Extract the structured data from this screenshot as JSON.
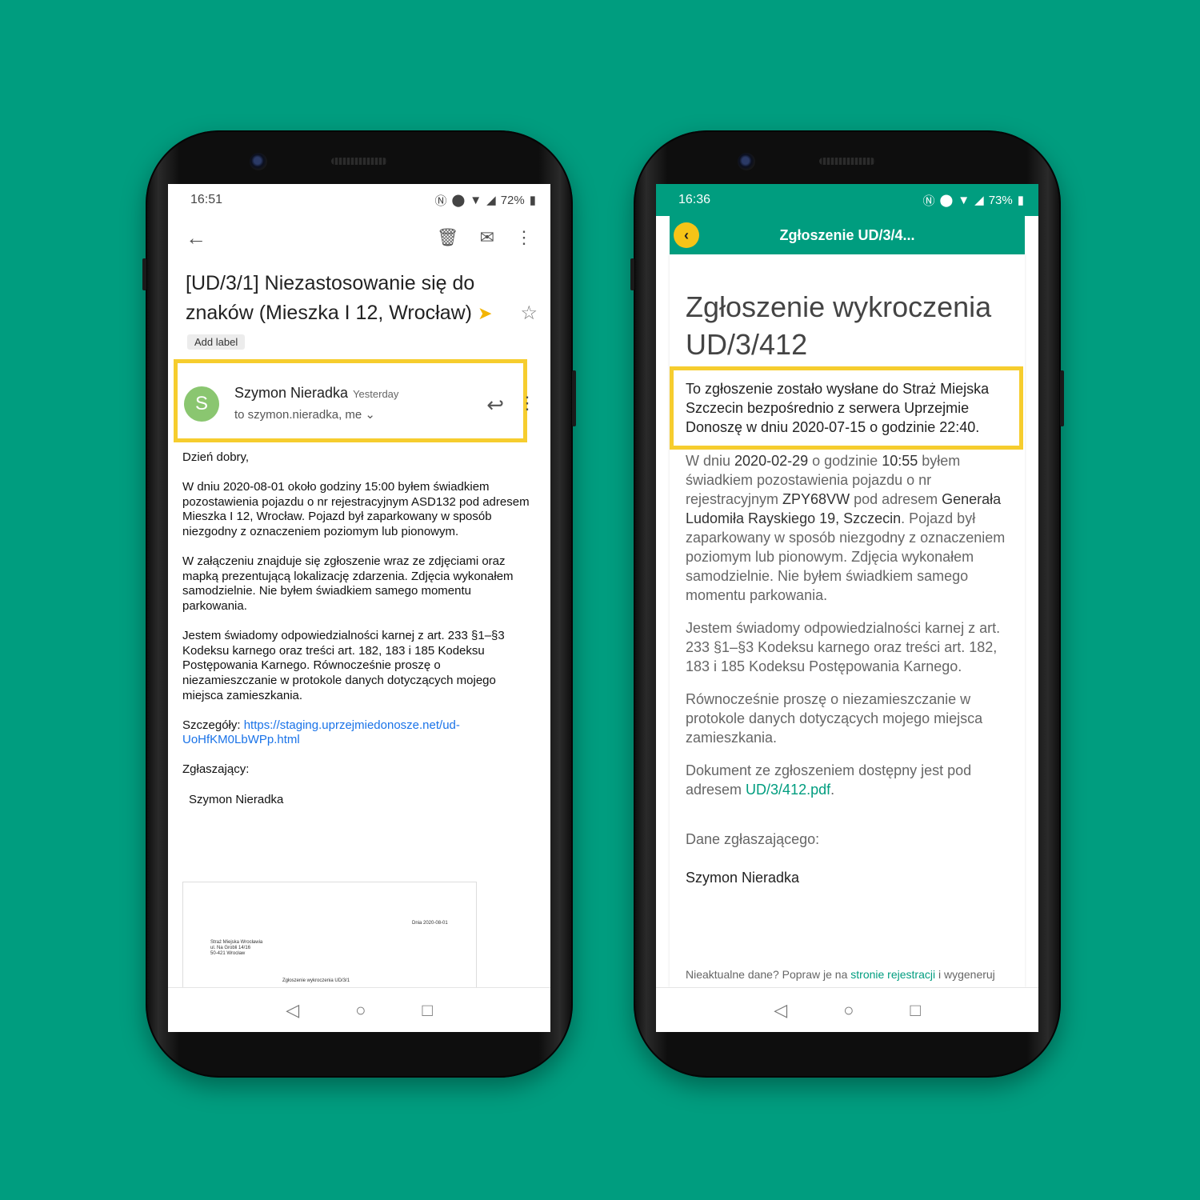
{
  "gmail": {
    "status": {
      "time": "16:51",
      "battery": "72%"
    },
    "toolbar": {
      "back_icon": "arrow-back-icon",
      "delete_icon": "trash-icon",
      "mail_icon": "mail-icon",
      "more_icon": "more-vert-icon"
    },
    "subject": "[UD/3/1] Niezastosowanie się do znaków (Mieszka I 12, Wrocław)",
    "add_label": "Add label",
    "sender": {
      "initial": "S",
      "name": "Szymon Nieradka",
      "when": "Yesterday",
      "to": "to szymon.nieradka, me"
    },
    "body": {
      "greeting": "Dzień dobry,",
      "p1": "W dniu 2020-08-01 około godziny 15:00 byłem świadkiem pozostawienia pojazdu o nr rejestracyjnym ASD132 pod adresem Mieszka I 12, Wrocław. Pojazd był zaparkowany w sposób niezgodny z oznaczeniem poziomym lub pionowym.",
      "p2": "W załączeniu znajduje się zgłoszenie wraz ze zdjęciami oraz mapką prezentującą lokalizację zdarzenia. Zdjęcia wykonałem samodzielnie.  Nie byłem świadkiem samego momentu parkowania.",
      "p3": "Jestem świadomy odpowiedzialności karnej z art. 233 §1–§3 Kodeksu karnego oraz treści art. 182, 183 i 185 Kodeksu Postępowania Karnego. Równocześnie proszę o niezamieszczanie w protokole danych dotyczących mojego miejsca zamieszkania.",
      "details_label": "Szczegóły:",
      "details_link": "https://staging.uprzejmiedonosze.net/ud-UoHfKM0LbWPp.html",
      "reporter_label": "Zgłaszający:",
      "reporter_name": "Szymon Nieradka"
    },
    "attachment": {
      "date": "Dnia 2020-08-01",
      "addr1": "Straż Miejska Wrocławia",
      "addr2": "ul. Na Grobli 14/16",
      "addr3": "50-421 Wrocław",
      "title": "Zgłoszenie wykroczenia UD/3/1"
    }
  },
  "webapp": {
    "status": {
      "time": "16:36",
      "battery": "73%"
    },
    "header_title": "Zgłoszenie UD/3/4...",
    "h1": "Zgłoszenie wykroczenia UD/3/412",
    "notice": "To zgłoszenie zostało wysłane do Straż Miejska Szczecin bezpośrednio z serwera Uprzejmie Donoszę w dniu 2020-07-15 o godzinie 22:40.",
    "p1": {
      "t1": "W dniu ",
      "date": "2020-02-29",
      "t2": " o godzinie ",
      "time": "10:55",
      "t3": " byłem świadkiem pozostawienia pojazdu o nr rejestracyjnym ",
      "plate": "ZPY68VW",
      "t4": " pod adresem ",
      "address": "Generała Ludomiła Rayskiego 19, Szczecin",
      "t5": ". Pojazd był zaparkowany w sposób niezgodny z oznaczeniem poziomym lub pionowym. Zdjęcia wykonałem samodzielnie. Nie byłem świadkiem samego momentu parkowania."
    },
    "p2": "Jestem świadomy odpowiedzialności karnej z art. 233 §1–§3 Kodeksu karnego oraz treści art. 182, 183 i 185 Kodeksu Postępowania Karnego.",
    "p3": "Równocześnie proszę o niezamieszczanie w protokole danych dotyczących mojego miejsca zamieszkania.",
    "p4": {
      "text": "Dokument ze zgłoszeniem dostępny jest pod adresem ",
      "link": "UD/3/412.pdf",
      "end": "."
    },
    "reporter_label": "Dane zgłaszającego:",
    "reporter_name": "Szymon Nieradka",
    "footer": {
      "text": "Nieaktualne dane? Popraw je na ",
      "link": "stronie rejestracji",
      "end": " i wygeneruj"
    }
  },
  "colors": {
    "background": "#009d7f",
    "highlight": "#f6cd2e",
    "accent": "#009d7f",
    "link_blue": "#1a73e8"
  }
}
